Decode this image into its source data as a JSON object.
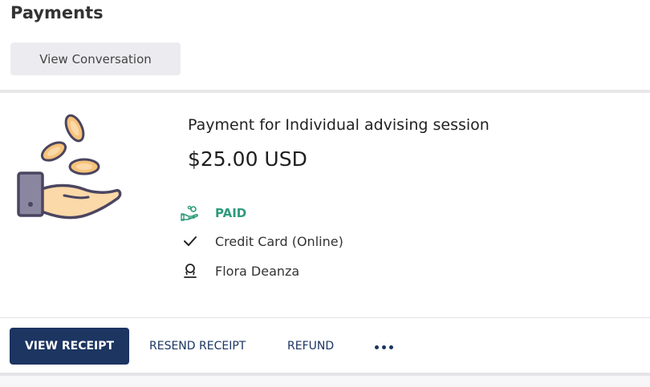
{
  "header": {
    "title": "Payments",
    "view_conversation_label": "View Conversation"
  },
  "payment": {
    "title": "Payment for Individual advising session",
    "amount": "$25.00 USD",
    "status": "PAID",
    "method": "Credit Card (Online)",
    "person": "Flora Deanza",
    "icons": {
      "illustration": "hand-with-coins-icon",
      "status": "money-hand-icon",
      "method": "checkmark-icon",
      "person": "person-icon"
    }
  },
  "actions": {
    "view_receipt": "VIEW RECEIPT",
    "resend_receipt": "RESEND RECEIPT",
    "refund": "REFUND",
    "more_icon": "more-horizontal-icon"
  },
  "colors": {
    "primary": "#1c3561",
    "paid": "#2e9b7b",
    "coin": "#f7c37a",
    "hand": "#fbd9a8",
    "outline": "#4b4560",
    "phone": "#8a86a0"
  }
}
